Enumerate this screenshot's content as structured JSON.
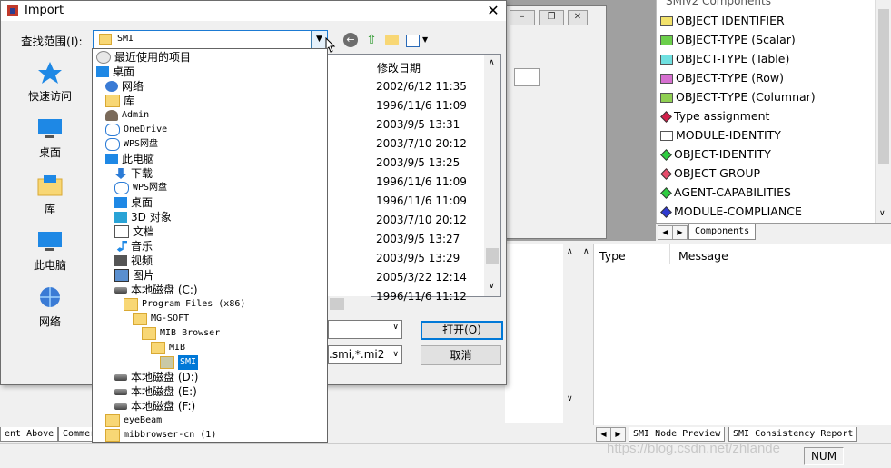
{
  "dialog": {
    "title": "Import",
    "close_glyph": "✕",
    "lookin_label": "查找范围(I):",
    "lookin_value": "SMI",
    "date_header": "修改日期",
    "dates": [
      "2002/6/12 11:35",
      "1996/11/6 11:09",
      "2003/9/5 13:31",
      "2003/7/10 20:12",
      "2003/9/5 13:25",
      "1996/11/6 11:09",
      "1996/11/6 11:09",
      "2003/7/10 20:12",
      "2003/9/5 13:27",
      "2003/9/5 13:29",
      "2005/3/22 12:14",
      "1996/11/6 11:12"
    ],
    "file_type_value": ".smi,*.mi2",
    "open_button": "打开(O)",
    "cancel_button": "取消",
    "places": [
      {
        "label": "快速访问",
        "icon": "star-icon"
      },
      {
        "label": "桌面",
        "icon": "desktop-icon"
      },
      {
        "label": "库",
        "icon": "library-icon"
      },
      {
        "label": "此电脑",
        "icon": "computer-icon"
      },
      {
        "label": "网络",
        "icon": "network-icon"
      }
    ]
  },
  "dropdown": {
    "items": [
      {
        "label": "最近使用的项目",
        "indent": 0,
        "icon": "recent-icon",
        "mono": false
      },
      {
        "label": "桌面",
        "indent": 0,
        "icon": "desktop-icon",
        "mono": false
      },
      {
        "label": "网络",
        "indent": 1,
        "icon": "network-icon",
        "mono": false
      },
      {
        "label": "库",
        "indent": 1,
        "icon": "library-icon",
        "mono": false
      },
      {
        "label": "Admin",
        "indent": 1,
        "icon": "user-icon",
        "mono": true
      },
      {
        "label": "OneDrive",
        "indent": 1,
        "icon": "cloud-icon",
        "mono": true
      },
      {
        "label": "WPS网盘",
        "indent": 1,
        "icon": "cloud-icon",
        "mono": true
      },
      {
        "label": "此电脑",
        "indent": 1,
        "icon": "computer-icon",
        "mono": false
      },
      {
        "label": "下载",
        "indent": 2,
        "icon": "download-icon",
        "mono": false
      },
      {
        "label": "WPS网盘",
        "indent": 2,
        "icon": "cloud-icon",
        "mono": true
      },
      {
        "label": "桌面",
        "indent": 2,
        "icon": "desktop-icon",
        "mono": false
      },
      {
        "label": "3D 对象",
        "indent": 2,
        "icon": "cube-icon",
        "mono": false
      },
      {
        "label": "文档",
        "indent": 2,
        "icon": "document-icon",
        "mono": false
      },
      {
        "label": "音乐",
        "indent": 2,
        "icon": "music-icon",
        "mono": false
      },
      {
        "label": "视频",
        "indent": 2,
        "icon": "video-icon",
        "mono": false
      },
      {
        "label": "图片",
        "indent": 2,
        "icon": "picture-icon",
        "mono": false
      },
      {
        "label": "本地磁盘 (C:)",
        "indent": 2,
        "icon": "drive-icon",
        "mono": false
      },
      {
        "label": "Program Files (x86)",
        "indent": 3,
        "icon": "folder-icon",
        "mono": true
      },
      {
        "label": "MG-SOFT",
        "indent": 4,
        "icon": "folder-icon",
        "mono": true
      },
      {
        "label": "MIB Browser",
        "indent": 5,
        "icon": "folder-icon",
        "mono": true
      },
      {
        "label": "MIB",
        "indent": 6,
        "icon": "folder-icon",
        "mono": true
      },
      {
        "label": "SMI",
        "indent": 7,
        "icon": "folder-icon",
        "mono": true,
        "selected": true
      },
      {
        "label": "本地磁盘 (D:)",
        "indent": 2,
        "icon": "drive-icon",
        "mono": false
      },
      {
        "label": "本地磁盘 (E:)",
        "indent": 2,
        "icon": "drive-icon",
        "mono": false
      },
      {
        "label": "本地磁盘 (F:)",
        "indent": 2,
        "icon": "drive-icon",
        "mono": false
      },
      {
        "label": "eyeBeam",
        "indent": 1,
        "icon": "folder-icon",
        "mono": true
      },
      {
        "label": "mibbrowser-cn (1)",
        "indent": 1,
        "icon": "folder-icon",
        "mono": true
      }
    ]
  },
  "components": {
    "header": "SMIv2 Components",
    "items": [
      {
        "label": "OBJECT IDENTIFIER",
        "color": "#f2e26b",
        "kind": "box"
      },
      {
        "label": "OBJECT-TYPE (Scalar)",
        "color": "#6bcf4a",
        "kind": "box"
      },
      {
        "label": "OBJECT-TYPE (Table)",
        "color": "#6fe0e0",
        "kind": "box"
      },
      {
        "label": "OBJECT-TYPE (Row)",
        "color": "#d66fd0",
        "kind": "box"
      },
      {
        "label": "OBJECT-TYPE (Columnar)",
        "color": "#8fcf52",
        "kind": "box"
      },
      {
        "label": "Type assignment",
        "color": "#d0204a",
        "kind": "gem"
      },
      {
        "label": "MODULE-IDENTITY",
        "color": "#ffffff",
        "kind": "box"
      },
      {
        "label": "OBJECT-IDENTITY",
        "color": "#2ecc40",
        "kind": "gem"
      },
      {
        "label": "OBJECT-GROUP",
        "color": "#e64a6a",
        "kind": "gem"
      },
      {
        "label": "AGENT-CAPABILITIES",
        "color": "#2ecc40",
        "kind": "gem"
      },
      {
        "label": "MODULE-COMPLIANCE",
        "color": "#2f3ad0",
        "kind": "gem"
      }
    ],
    "tab": "Components"
  },
  "messages": {
    "col_type": "Type",
    "col_message": "Message"
  },
  "bottom_tabs_left": [
    "ent Above",
    "Commer"
  ],
  "bottom_tabs_right": [
    "SMI Node Preview",
    "SMI Consistency Report"
  ],
  "status": {
    "num": "NUM"
  },
  "watermark": "https://blog.csdn.net/zhlande"
}
